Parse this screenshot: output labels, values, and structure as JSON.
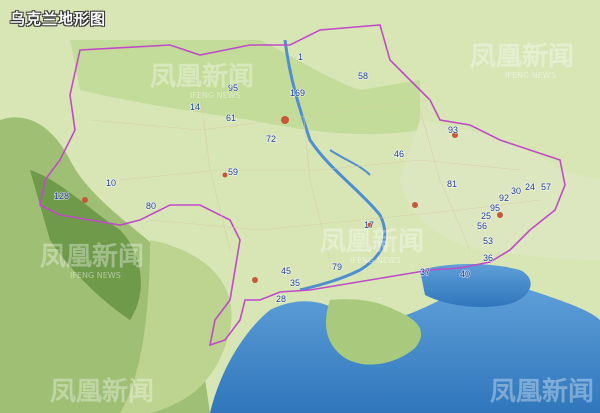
{
  "title": "乌克兰地形图",
  "watermark": {
    "text": "凤凰新闻",
    "sub": "IFENG NEWS"
  },
  "colors": {
    "sea": "#3f86c9",
    "border": "#c04bc8",
    "land_green": "#cfe2a8",
    "mountain": "#7da25a",
    "label": "#1d3f94"
  },
  "region_numbers": [
    "1",
    "58",
    "95",
    "169",
    "14",
    "61",
    "72",
    "93",
    "46",
    "59",
    "10",
    "81",
    "128",
    "80",
    "92",
    "30",
    "24",
    "57",
    "95",
    "25",
    "56",
    "53",
    "17",
    "36",
    "45",
    "79",
    "37",
    "40",
    "35",
    "28"
  ]
}
